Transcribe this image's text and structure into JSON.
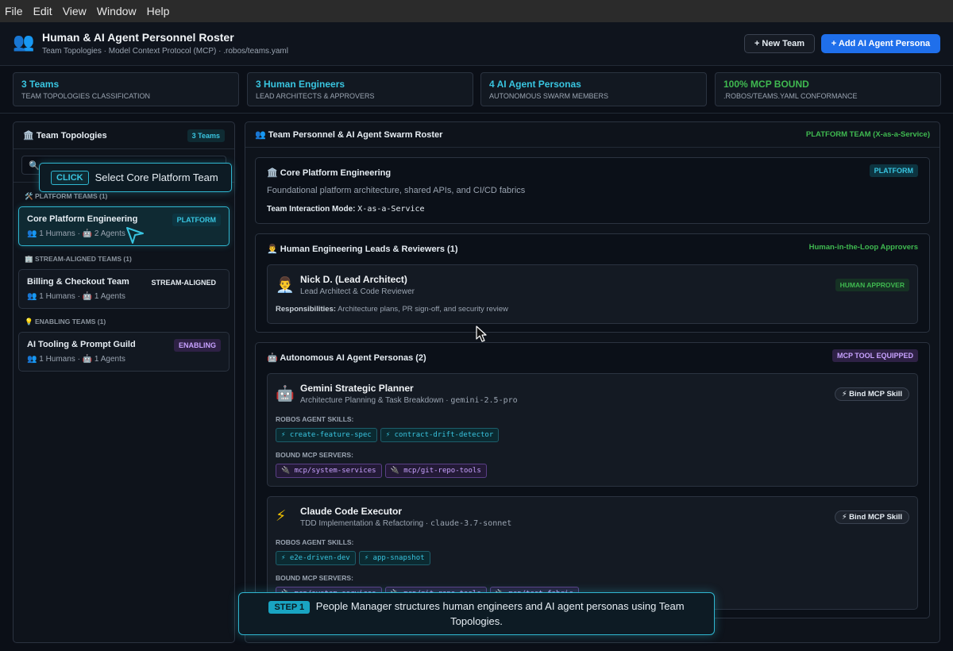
{
  "menu": [
    "File",
    "Edit",
    "View",
    "Window",
    "Help"
  ],
  "header": {
    "icon": "people-icon",
    "title": "Human & AI Agent Personnel Roster",
    "subtitle": "Team Topologies · Model Context Protocol (MCP) · .robos/teams.yaml",
    "new_team": "+ New Team",
    "add_agent": "+ Add AI Agent Persona"
  },
  "stats": [
    {
      "value": "3 Teams",
      "label": "Team Topologies Classification"
    },
    {
      "value": "3 Human Engineers",
      "label": "Lead Architects & Approvers"
    },
    {
      "value": "4 AI Agent Personas",
      "label": "Autonomous Swarm Members"
    },
    {
      "value": "100% MCP BOUND",
      "label": ".robos/teams.yaml Conformance"
    }
  ],
  "left": {
    "title": "🏛️ Team Topologies",
    "count": "3 Teams",
    "search_icon": "🔍",
    "groups": [
      {
        "label": "🛠️ Platform Teams (1)"
      },
      {
        "label": "🏢 Stream-Aligned Teams (1)"
      },
      {
        "label": "💡 Enabling Teams (1)"
      }
    ],
    "teams": [
      {
        "name": "Core Platform Engineering",
        "tag": "PLATFORM",
        "meta": "👥 1 Humans · 🤖 2 Agents"
      },
      {
        "name": "Billing & Checkout Team",
        "tag": "STREAM-ALIGNED",
        "meta": "👥 1 Humans · 🤖 1 Agents"
      },
      {
        "name": "AI Tooling & Prompt Guild",
        "tag": "ENABLING",
        "meta": "👥 1 Humans · 🤖 1 Agents"
      }
    ]
  },
  "tooltip": {
    "tag": "CLICK",
    "text": "Select Core Platform Team"
  },
  "right": {
    "title": "👥 Team Personnel & AI Agent Swarm Roster",
    "context": "PLATFORM TEAM (X-as-a-Service)",
    "team_card": {
      "title": "🏛️ Core Platform Engineering",
      "tag": "PLATFORM",
      "description": "Foundational platform architecture, shared APIs, and CI/CD fabrics",
      "mode_label": "Team Interaction Mode:",
      "mode_value": "X-as-a-Service"
    },
    "humans": {
      "title": "👨‍💼 Human Engineering Leads & Reviewers (1)",
      "right": "Human-in-the-Loop Approvers",
      "people": [
        {
          "icon": "👨‍💼",
          "name": "Nick D. (Lead Architect)",
          "role": "Lead Architect & Code Reviewer",
          "badge": "HUMAN APPROVER",
          "resp_label": "Responsibilities:",
          "resp": "Architecture plans, PR sign-off, and security review"
        }
      ]
    },
    "agents": {
      "title": "🤖 Autonomous AI Agent Personas (2)",
      "right": "MCP TOOL EQUIPPED",
      "skills_label": "ROBOS AGENT SKILLS:",
      "mcp_label": "BOUND MCP SERVERS:",
      "bind_label": "⚡ Bind MCP Skill",
      "list": [
        {
          "icon": "🤖",
          "name": "Gemini Strategic Planner",
          "role": "Architecture Planning & Task Breakdown · ",
          "model": "gemini-2.5-pro",
          "skills": [
            "⚡ create-feature-spec",
            "⚡ contract-drift-detector"
          ],
          "mcp": [
            "🔌 mcp/system-services",
            "🔌 mcp/git-repo-tools"
          ]
        },
        {
          "icon": "⚡",
          "name": "Claude Code Executor",
          "role": "TDD Implementation & Refactoring · ",
          "model": "claude-3.7-sonnet",
          "skills": [
            "⚡ e2e-driven-dev",
            "⚡ app-snapshot"
          ],
          "mcp": [
            "🔌 mcp/system-services",
            "🔌 mcp/git-repo-tools",
            "🔌 mcp/test-fabric"
          ]
        }
      ]
    }
  },
  "step": {
    "tag": "STEP 1",
    "text": "People Manager structures human engineers and AI agent personas using Team Topologies."
  }
}
